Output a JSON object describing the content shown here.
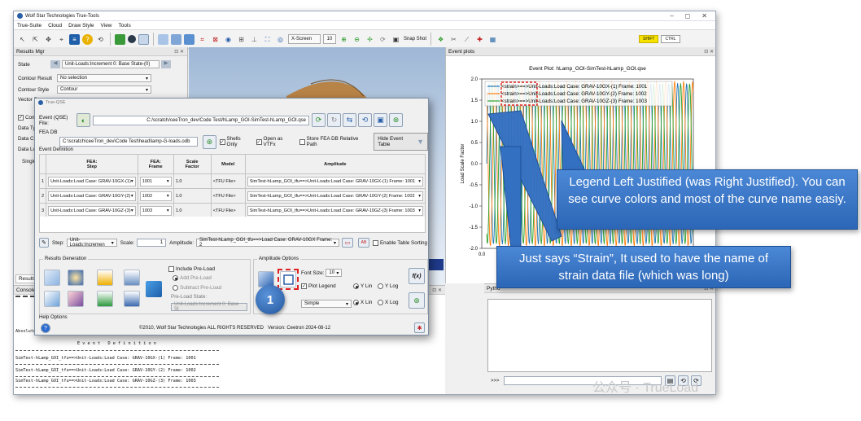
{
  "app": {
    "title": "Wolf Star Technologies True-Tools",
    "menu": [
      "True-Suite",
      "Cloud",
      "Draw Style",
      "View",
      "Tools"
    ],
    "toolbar": {
      "screen_mode": "X-Screen",
      "screen_value": "10",
      "snap_label": "Snap Shot",
      "shift_label": "SHIFT",
      "ctrl_label": "CTRL"
    },
    "window_controls": [
      "–",
      "◻",
      "✕"
    ]
  },
  "results_mgr": {
    "title": "Results Mgr",
    "state_label": "State",
    "state_value": "Unit-Loads:Increment 0: Base State-(0)",
    "contour_result_label": "Contour Result",
    "contour_result_value": "No selection",
    "contour_style_label": "Contour Style",
    "contour_style_value": "Contour",
    "vector_label": "Vector R",
    "side_labels": [
      "Conto",
      "Data Typ",
      "Data Co",
      "Data Lo",
      "Single"
    ],
    "tab_label": "Results"
  },
  "console": {
    "title": "Console O",
    "absolute_label": "Absolute",
    "section_title": "E v e n t   D e f i n i t i o n",
    "lines": [
      "SimTest-hLamp_GOI_tfu==>Unit-Loads:Load Case: GRAV-10GX-(1) Frame: 1001",
      "SimTest-hLamp_GOI_tfu==>Unit-Loads:Load Case: GRAV-10GY-(2) Frame: 1002",
      "SimTest-hLamp_GOI_tfu==>Unit-Loads:Load Case: GRAV-10GZ-(3) Frame: 1003"
    ]
  },
  "dialog": {
    "title": "True-QSE",
    "event_file_label": "Event (QSE) File:",
    "event_file_path": "C:/scratch/ceeTron_dev/Code Test/hLamp_GOI-SimTest-hLamp_GOI.qse",
    "fea_db_label": "FEA DB",
    "fea_db_path": "C:\\scratch\\ceeTron_dev\\Code Test\\head\\lamp-G-loads.odb",
    "shells_only": "Shells Only",
    "open_vtfx": "Open as VTFx",
    "store_relative": "Store FEA DB Relative Path",
    "hide_event_table": "Hide Event Table",
    "event_definition_label": "Event Definition",
    "table_headers": [
      "FEA:\nStep",
      "FEA:\nFrame",
      "Scale\nFactor",
      "Model",
      "Amplitude"
    ],
    "rows": [
      {
        "num": "1",
        "step": "Unit-Loads:Load Case: GRAV-10GX-(1)",
        "frame": "1001",
        "scale": "1.0",
        "model": "<TFU File>",
        "amp": "SimTest-hLamp_GOI_tfu==>Unit-Loads:Load Case: GRAV-10GX-(1) Frame: 1001"
      },
      {
        "num": "2",
        "step": "Unit-Loads:Load Case: GRAV-10GY-(2)",
        "frame": "1002",
        "scale": "1.0",
        "model": "<TFU File>",
        "amp": "SimTest-hLamp_GOI_tfu==>Unit-Loads:Load Case: GRAV-10GY-(2) Frame: 1002"
      },
      {
        "num": "3",
        "step": "Unit-Loads:Load Case: GRAV-10GZ-(3)",
        "frame": "1003",
        "scale": "1.0",
        "model": "<TFU File>",
        "amp": "SimTest-hLamp_GOI_tfu==>Unit-Loads:Load Case: GRAV-10GZ-(3) Frame: 1003"
      }
    ],
    "step_label": "Step:",
    "step_value": "Unit-Loads:Incremen",
    "scale_label": "Scale:",
    "scale_value": "1",
    "amplitude_label": "Amplitude:",
    "amplitude_value": "SimTest-hLamp_GOI_tfu==>Load Case: GRAV-10GX Frame: 2",
    "enable_sorting": "Enable Table Sorting",
    "results_generation": "Results Generation",
    "include_preload": "Include Pre-Load",
    "add_preload": "Add Pre-Load",
    "subtract_preload": "Subtract Pre-Load",
    "preload_state_label": "Pre-Load State:",
    "preload_state_value": "Unit-Loads:Increment 0: Base St",
    "amplitude_options": "Amplitude Options",
    "font_size_label": "Font Size:",
    "font_size_value": "10",
    "plot_legend": "Plot Legend",
    "y_lin": "Y Lin",
    "y_log": "Y Log",
    "x_lin": "X Lin",
    "x_log": "X Log",
    "style_value": "Simple",
    "help_options": "Help Options",
    "copyright": "©2010, Wolf Star Technologies  ALL RIGHTS RESERVED",
    "version": "Version: Ceetron 2024-08-12",
    "fx_label": "f(x)",
    "badge": "1"
  },
  "event_plots": {
    "panel_title": "Event plots",
    "python_label": "Pytho",
    "prompt": ">>>",
    "chart_data": {
      "type": "line",
      "title": "Event Plot: hLamp_GOI-SimTest-hLamp_GOI.qse",
      "ylabel": "Load Scale Factor",
      "xlabel": "",
      "ylim": [
        -2.0,
        2.0
      ],
      "y_ticks": [
        "2.0",
        "1.5",
        "1.0",
        "0.5",
        "0.0",
        "-0.5",
        "-1.0",
        "-1.5",
        "-2.0"
      ],
      "x_ticks": [
        "0.0"
      ],
      "legend_position": "top-left",
      "series": [
        {
          "name": "<strain>==>Unit-Loads:Load Case: GRAV-10GX-(1) Frame: 1001",
          "color": "#1f77b4"
        },
        {
          "name": "<strain>==>Unit-Loads:Load Case: GRAV-10GY-(2) Frame: 1002",
          "color": "#ff7f0e"
        },
        {
          "name": "<strain>==>Unit-Loads:Load Case: GRAV-10GZ-(3) Frame: 1003",
          "color": "#2ca02c"
        }
      ]
    }
  },
  "callouts": {
    "legend": "Legend Left Justified (was Right Justified). You can see curve colors and most of the curve name easiy.",
    "strain": "Just says “Strain”, It used to have the name of strain data file (which was long)"
  },
  "watermark": "公众号 · TrueLoad",
  "colors": {
    "callout": "#2f6cbf",
    "highlight": "#e02020",
    "accent": "#1f5ea8"
  }
}
